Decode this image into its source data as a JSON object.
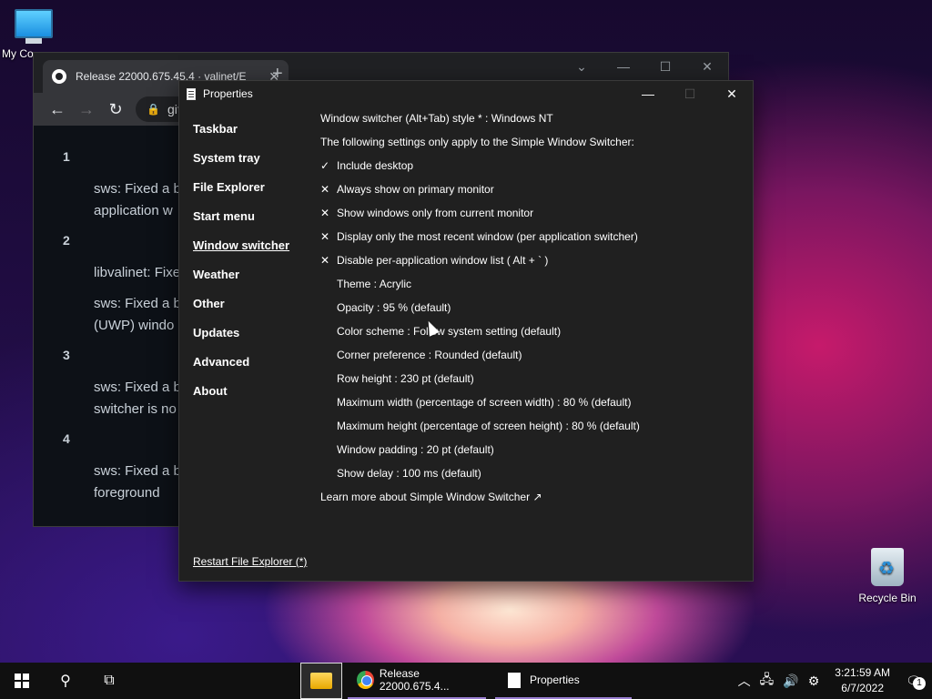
{
  "desktop": {
    "this_pc_label": "My Co",
    "recycle_bin_label": "Recycle Bin"
  },
  "browser": {
    "tab_title": "Release 22000.675.45.4 · valinet/E",
    "address": "git",
    "content": {
      "sections": [
        {
          "num": "1",
          "items": [
            "sws: Fixed a b",
            "application w"
          ]
        },
        {
          "num": "2",
          "items": [
            "libvalinet: Fixe",
            "sws: Fixed a b",
            "(UWP) windo"
          ]
        },
        {
          "num": "3",
          "items": [
            "sws: Fixed a b",
            "switcher is no"
          ]
        },
        {
          "num": "4",
          "items": [
            "sws: Fixed a b",
            "foreground"
          ]
        }
      ]
    }
  },
  "properties": {
    "title": "Properties",
    "sidebar": [
      {
        "label": "Taskbar",
        "active": false
      },
      {
        "label": "System tray",
        "active": false
      },
      {
        "label": "File Explorer",
        "active": false
      },
      {
        "label": "Start menu",
        "active": false
      },
      {
        "label": "Window switcher",
        "active": true
      },
      {
        "label": "Weather",
        "active": false
      },
      {
        "label": "Other",
        "active": false
      },
      {
        "label": "Updates",
        "active": false
      },
      {
        "label": "Advanced",
        "active": false
      },
      {
        "label": "About",
        "active": false
      }
    ],
    "restart_link": "Restart File Explorer (*)",
    "style_line": "Window switcher (Alt+Tab) style * : Windows NT",
    "note": "The following settings only apply to the Simple Window Switcher:",
    "options": [
      {
        "mark": "✓",
        "label": "Include desktop"
      },
      {
        "mark": "✕",
        "label": "Always show on primary monitor"
      },
      {
        "mark": "✕",
        "label": "Show windows only from current monitor"
      },
      {
        "mark": "✕",
        "label": "Display only the most recent window (per application switcher)"
      },
      {
        "mark": "✕",
        "label": "Disable per-application window list ( Alt + ` )"
      }
    ],
    "settings": [
      "Theme : Acrylic",
      "Opacity : 95 % (default)",
      "Color scheme : Follow system setting (default)",
      "Corner preference : Rounded (default)",
      "Row height : 230 pt (default)",
      "Maximum width (percentage of screen width) : 80 % (default)",
      "Maximum height (percentage of screen height) : 80 % (default)",
      "Window padding : 20 pt (default)",
      "Show delay : 100 ms (default)"
    ],
    "learn_more": "Learn more about Simple Window Switcher ↗"
  },
  "taskbar": {
    "chrome_label": "Release 22000.675.4...",
    "properties_label": "Properties",
    "time": "3:21:59 AM",
    "date": "6/7/2022",
    "notification_count": "1"
  }
}
